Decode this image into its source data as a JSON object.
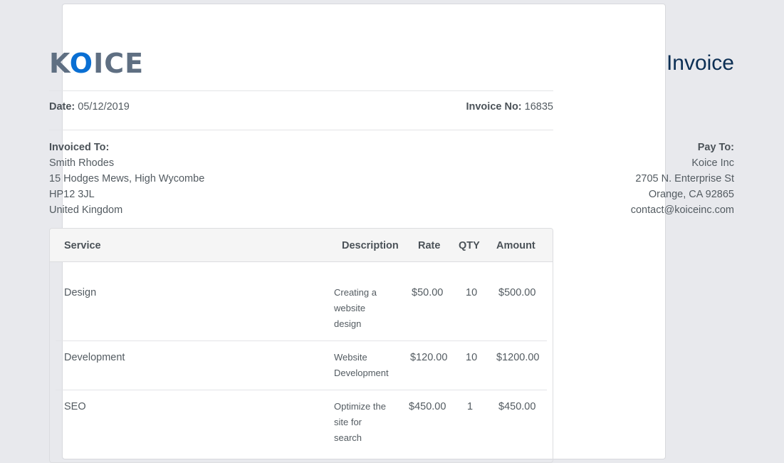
{
  "brand": {
    "logo_pre": "K",
    "logo_o": "O",
    "logo_post": "ICE"
  },
  "header": {
    "title": "Invoice"
  },
  "meta": {
    "date_label": "Date:",
    "date_value": "05/12/2019",
    "invoice_no_label": "Invoice No:",
    "invoice_no_value": "16835"
  },
  "invoiced_to": {
    "label": "Invoiced To:",
    "lines": [
      "Smith Rhodes",
      "15 Hodges Mews, High Wycombe",
      "HP12 3JL",
      "United Kingdom"
    ]
  },
  "pay_to": {
    "label": "Pay To:",
    "lines": [
      "Koice Inc",
      "2705 N. Enterprise St",
      "Orange, CA 92865",
      "contact@koiceinc.com"
    ]
  },
  "table": {
    "headers": {
      "service": "Service",
      "description": "Description",
      "rate": "Rate",
      "qty": "QTY",
      "amount": "Amount"
    },
    "rows": [
      {
        "service": "Design",
        "description": [
          "Creating a",
          "website",
          "design"
        ],
        "rate": "$50.00",
        "qty": "10",
        "amount": "$500.00"
      },
      {
        "service": "Development",
        "description": [
          "Website",
          "Development"
        ],
        "rate": "$120.00",
        "qty": "10",
        "amount": "$1200.00"
      },
      {
        "service": "SEO",
        "description": [
          "Optimize the",
          "site for",
          "search"
        ],
        "rate": "$450.00",
        "qty": "1",
        "amount": "$450.00"
      }
    ]
  }
}
